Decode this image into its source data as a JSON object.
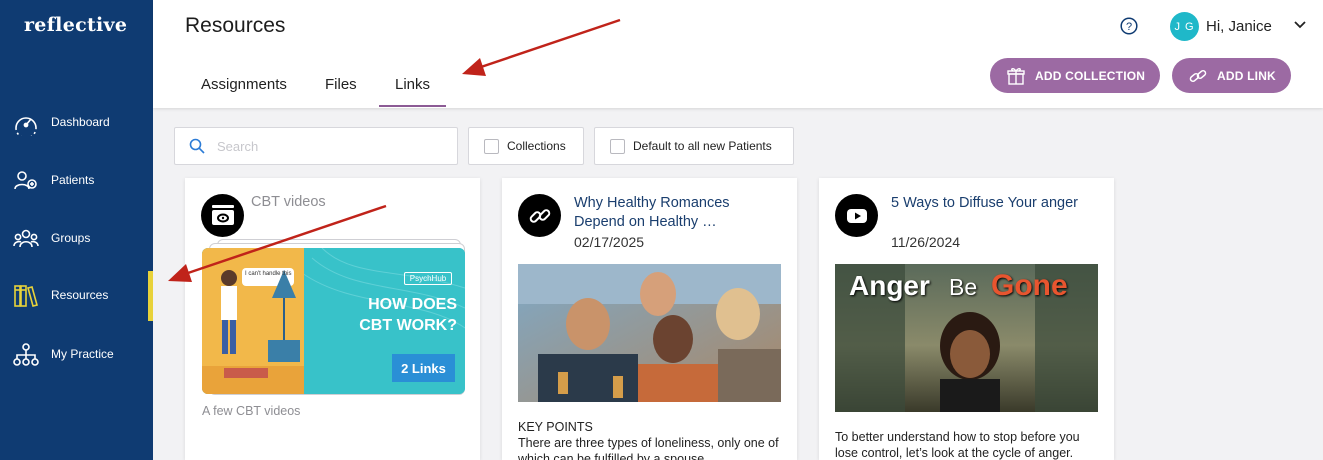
{
  "app": {
    "logo": "reflective"
  },
  "sidebar": {
    "items": [
      {
        "label": "Dashboard",
        "icon": "gauge-icon"
      },
      {
        "label": "Patients",
        "icon": "patients-icon"
      },
      {
        "label": "Groups",
        "icon": "groups-icon"
      },
      {
        "label": "Resources",
        "icon": "books-icon"
      },
      {
        "label": "My Practice",
        "icon": "org-chart-icon"
      }
    ],
    "active": "Resources",
    "active_color": "#e8d23a",
    "background": "#0f3b72"
  },
  "header": {
    "title": "Resources",
    "tabs": [
      "Assignments",
      "Files",
      "Links"
    ],
    "active_tab": "Links",
    "user": {
      "initials": "J G",
      "greeting": "Hi, Janice"
    },
    "buttons": {
      "add_collection": "ADD COLLECTION",
      "add_link": "ADD LINK"
    },
    "accent": "#9c6aa3"
  },
  "filters": {
    "search_placeholder": "Search",
    "search_value": "",
    "collections_label": "Collections",
    "collections_checked": false,
    "default_label": "Default to all new Patients",
    "default_checked": false
  },
  "cards": [
    {
      "type": "collection",
      "title": "CBT videos",
      "description": "A few CBT videos",
      "thumb": {
        "badge": "PsychHub",
        "headline_1": "HOW DOES",
        "headline_2": "CBT WORK?",
        "links_count": "2 Links",
        "speech": "I can't handle this"
      }
    },
    {
      "type": "link",
      "title": "Why Healthy Romances Depend on Healthy …",
      "date": "02/17/2025",
      "heading": "KEY POINTS",
      "text": "There are three types of loneliness, only one of which can be fulfilled by a spouse."
    },
    {
      "type": "video",
      "title": "5 Ways to Diffuse Your anger",
      "date": "11/26/2024",
      "thumb": {
        "word_1": "Anger",
        "word_2": "Be",
        "word_3": "Gone"
      },
      "text": "To better understand how to stop before you lose control, let’s look at the cycle of anger."
    }
  ]
}
